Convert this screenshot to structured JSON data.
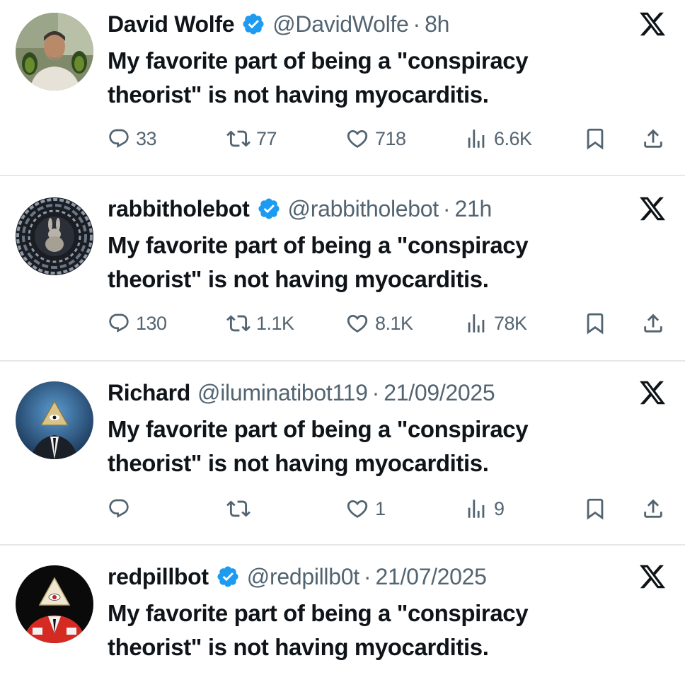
{
  "brand": {
    "verified_color": "#1d9bf0",
    "text_color": "#0f1419",
    "muted_color": "#536471",
    "x_logo_icon": "x-logo-icon"
  },
  "tweets": [
    {
      "name": "David Wolfe",
      "verified": true,
      "handle": "@DavidWolfe",
      "separator": "·",
      "time": "8h",
      "text": "My favorite part of being a \"conspiracy\ntheorist\" is not having myocarditis.",
      "avatar_icon": "man-holding-avocados-avatar",
      "replies": "33",
      "reposts": "77",
      "likes": "718",
      "views": "6.6K"
    },
    {
      "name": "rabbitholebot",
      "verified": true,
      "handle": "@rabbitholebot",
      "separator": "·",
      "time": "21h",
      "text": "My favorite part of being a \"conspiracy\ntheorist\" is not having myocarditis.",
      "avatar_icon": "rabbit-in-maze-avatar",
      "replies": "130",
      "reposts": "1.1K",
      "likes": "8.1K",
      "views": "78K"
    },
    {
      "name": "Richard",
      "verified": false,
      "handle": "@iluminatibot119",
      "separator": "·",
      "time": "21/09/2025",
      "text": "My favorite part of being a \"conspiracy\ntheorist\" is not having myocarditis.",
      "avatar_icon": "pyramid-eye-suit-avatar",
      "replies": "",
      "reposts": "",
      "likes": "1",
      "views": "9"
    },
    {
      "name": "redpillbot",
      "verified": true,
      "handle": "@redpillb0t",
      "separator": "·",
      "time": "21/07/2025",
      "text": "My favorite part of being a \"conspiracy\ntheorist\" is not having myocarditis.",
      "avatar_icon": "pyramid-eye-red-suit-avatar"
    }
  ]
}
